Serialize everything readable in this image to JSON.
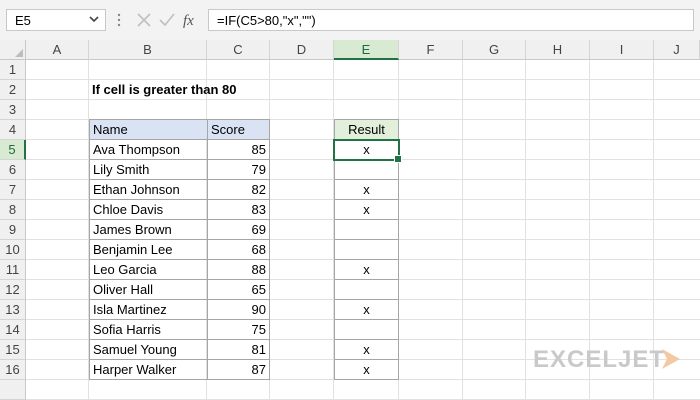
{
  "formula_bar": {
    "name_box": "E5",
    "formula": "=IF(C5>80,\"x\",\"\")",
    "fx_label": "fx"
  },
  "columns": [
    "A",
    "B",
    "C",
    "D",
    "E",
    "F",
    "G",
    "H",
    "I",
    "J"
  ],
  "rows": [
    "1",
    "2",
    "3",
    "4",
    "5",
    "6",
    "7",
    "8",
    "9",
    "10",
    "11",
    "12",
    "13",
    "14",
    "15",
    "16"
  ],
  "sheet": {
    "title": "If cell is greater than 80",
    "headers": {
      "name": "Name",
      "score": "Score",
      "result": "Result"
    },
    "records": [
      {
        "name": "Ava Thompson",
        "score": "85",
        "result": "x"
      },
      {
        "name": "Lily Smith",
        "score": "79",
        "result": ""
      },
      {
        "name": "Ethan Johnson",
        "score": "82",
        "result": "x"
      },
      {
        "name": "Chloe Davis",
        "score": "83",
        "result": "x"
      },
      {
        "name": "James Brown",
        "score": "69",
        "result": ""
      },
      {
        "name": "Benjamin Lee",
        "score": "68",
        "result": ""
      },
      {
        "name": "Leo Garcia",
        "score": "88",
        "result": "x"
      },
      {
        "name": "Oliver Hall",
        "score": "65",
        "result": ""
      },
      {
        "name": "Isla Martinez",
        "score": "90",
        "result": "x"
      },
      {
        "name": "Sofia Harris",
        "score": "75",
        "result": ""
      },
      {
        "name": "Samuel Young",
        "score": "81",
        "result": "x"
      },
      {
        "name": "Harper Walker",
        "score": "87",
        "result": "x"
      }
    ]
  },
  "logo": "EXCELJET",
  "colors": {
    "accent": "#217346",
    "table_header": "#dae3f3",
    "result_header": "#e2efda"
  }
}
